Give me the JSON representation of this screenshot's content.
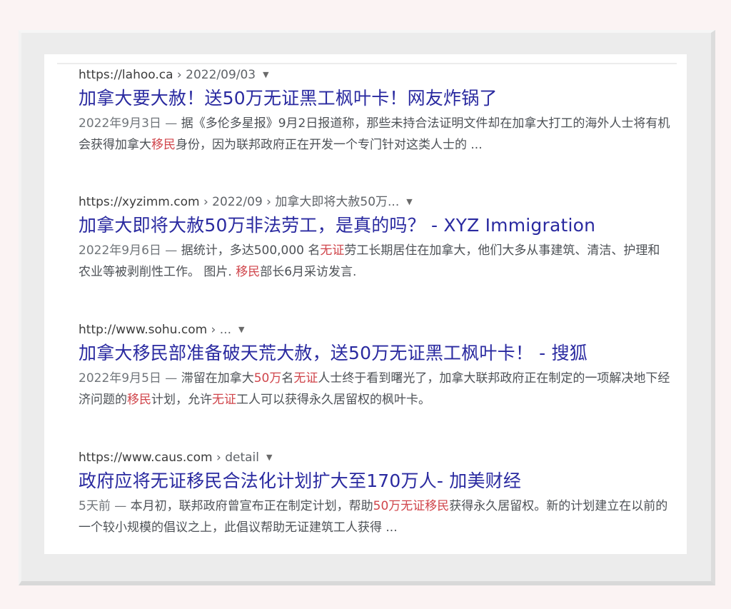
{
  "results": [
    {
      "url": "https://lahoo.ca",
      "crumbs": " › 2022/09/03",
      "title": "加拿大要大赦！送50万无证黑工枫叶卡！网友炸锅了",
      "date": "2022年9月3日 — ",
      "snippet_parts": [
        {
          "text": "据《多伦多星报》9月2日报道称，那些未持合法证明文件却在加拿大打工的海外人士将有机会获得加拿大",
          "hl": false
        },
        {
          "text": "移民",
          "hl": true
        },
        {
          "text": "身份，因为联邦政府正在开发一个专门针对这类人士的 ...",
          "hl": false
        }
      ]
    },
    {
      "url": "https://xyzimm.com",
      "crumbs": " › 2022/09 › 加拿大即将大赦50万...",
      "title": "加拿大即将大赦50万非法劳工，是真的吗？ - XYZ Immigration",
      "date": "2022年9月6日 — ",
      "snippet_parts": [
        {
          "text": "据统计，多达500,000 名",
          "hl": false
        },
        {
          "text": "无证",
          "hl": true
        },
        {
          "text": "劳工长期居住在加拿大，他们大多从事建筑、清洁、护理和农业等被剥削性工作。 图片. ",
          "hl": false
        },
        {
          "text": "移民",
          "hl": true
        },
        {
          "text": "部长6月采访发言.",
          "hl": false
        }
      ]
    },
    {
      "url": "http://www.sohu.com",
      "crumbs": " › ...",
      "title": "加拿大移民部准备破天荒大赦，送50万无证黑工枫叶卡！ - 搜狐",
      "date": "2022年9月5日 — ",
      "snippet_parts": [
        {
          "text": "滞留在加拿大",
          "hl": false
        },
        {
          "text": "50万",
          "hl": true
        },
        {
          "text": "名",
          "hl": false
        },
        {
          "text": "无证",
          "hl": true
        },
        {
          "text": "人士终于看到曙光了，加拿大联邦政府正在制定的一项解决地下经济问题的",
          "hl": false
        },
        {
          "text": "移民",
          "hl": true
        },
        {
          "text": "计划，允许",
          "hl": false
        },
        {
          "text": "无证",
          "hl": true
        },
        {
          "text": "工人可以获得永久居留权的枫叶卡。",
          "hl": false
        }
      ]
    },
    {
      "url": "https://www.caus.com",
      "crumbs": " › detail",
      "title": "政府应将无证移民合法化计划扩大至170万人- 加美财经",
      "date": "5天前 — ",
      "snippet_parts": [
        {
          "text": "本月初，联邦政府曾宣布正在制定计划，帮助",
          "hl": false
        },
        {
          "text": "50万无证移民",
          "hl": true
        },
        {
          "text": "获得永久居留权。新的计划建立在以前的一个较小规模的倡议之上，此倡议帮助无证建筑工人获得 ...",
          "hl": false
        }
      ]
    }
  ],
  "icons": {
    "dropdown": "caret-down-icon"
  }
}
